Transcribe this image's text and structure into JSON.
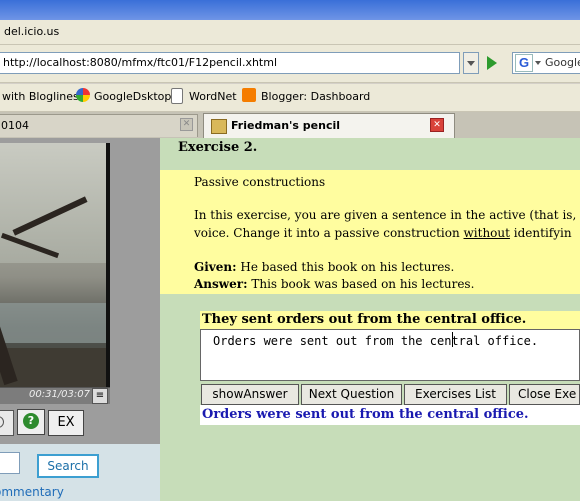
{
  "browser": {
    "menu_text": "del.icio.us",
    "url": "http://localhost:8080/mfmx/ftc01/F12pencil.xhtml",
    "search_placeholder": "Google",
    "bookmarks": [
      {
        "label": "with Bloglines",
        "icon": "bloglines-icon"
      },
      {
        "label": "GoogleDsktop",
        "icon": "googledesktop-icon"
      },
      {
        "label": "WordNet",
        "icon": "page-icon"
      },
      {
        "label": "Blogger: Dashboard",
        "icon": "blogger-icon"
      }
    ],
    "tabs": [
      {
        "label": "0104",
        "active": false
      },
      {
        "label": "Friedman's pencil",
        "active": true
      }
    ]
  },
  "player": {
    "time": "00:31/03:07",
    "ex_label": "EX",
    "help_label": "?"
  },
  "sidebar": {
    "search_button": "Search",
    "commentary_link": "ommentary"
  },
  "exercise": {
    "title": "Exercise 2.",
    "topic": "Passive constructions",
    "instr_line1": "In this exercise, you are given a sentence in the active (that is,",
    "instr_line2_before": "voice. Change it into a passive construction ",
    "instr_line2_underlined": "without",
    "instr_line2_after": " identifyin",
    "given_label": "Given:",
    "given_text": " He based this book on his lectures.",
    "answer_label": "Answer:",
    "answer_text": " This book was based on his lectures.",
    "prompt_sentence": "They sent orders out from the central office.",
    "user_answer": "Orders were sent out from the central office.",
    "feedback": "Orders were sent out from the central office.",
    "buttons": {
      "show_answer": "showAnswer",
      "next_question": "Next Question",
      "exercises_list": "Exercises List",
      "close": "Close Exe"
    }
  },
  "colors": {
    "content_bg": "#c7ddb9",
    "highlight": "#fffd9f",
    "feedback_text": "#1a1ab0"
  }
}
